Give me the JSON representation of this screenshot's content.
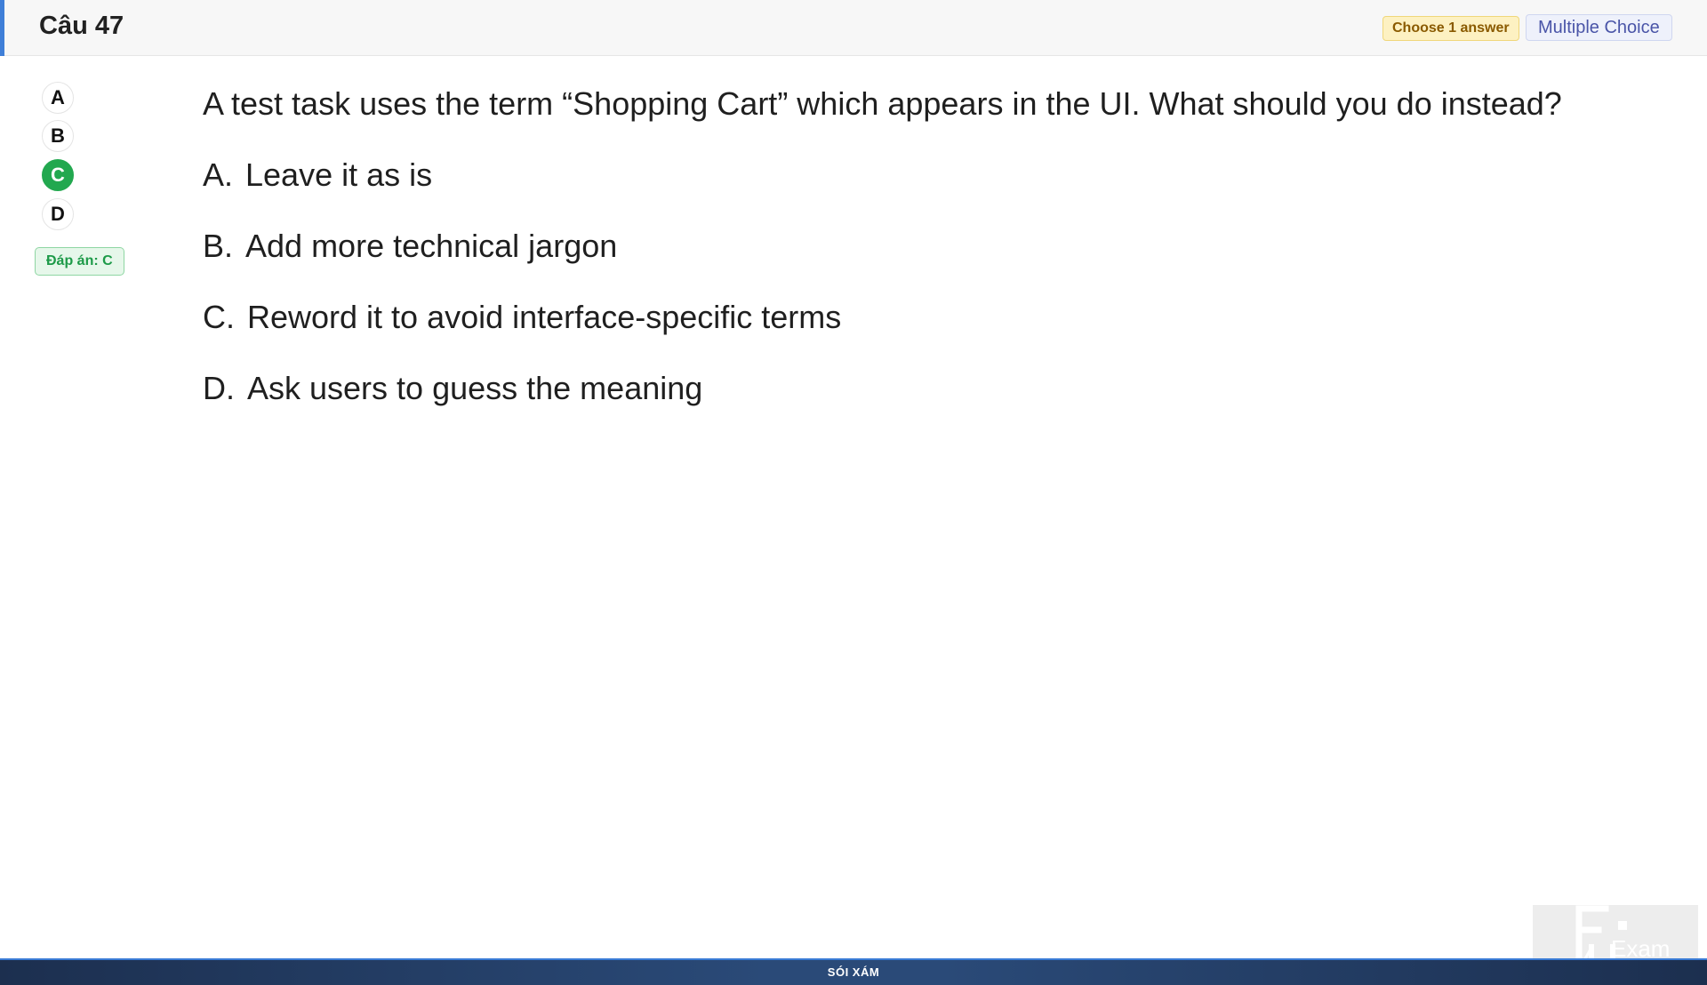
{
  "header": {
    "question_number": "Câu 47",
    "badge_choose": "Choose 1 answer",
    "badge_type": "Multiple Choice"
  },
  "answer_sidebar": {
    "options": [
      "A",
      "B",
      "C",
      "D"
    ],
    "selected": "C",
    "answer_label": "Đáp án: C"
  },
  "question": {
    "text": "A test task uses the term “Shopping Cart” which appears in the UI. What should you do instead?",
    "options": [
      {
        "letter": "A.",
        "text": "Leave it as is"
      },
      {
        "letter": "B.",
        "text": "Add more technical jargon"
      },
      {
        "letter": "C.",
        "text": "Reword it to avoid interface-specific terms"
      },
      {
        "letter": "D.",
        "text": "Ask users to guess the meaning"
      }
    ]
  },
  "footer": {
    "label": "SÓI XÁM"
  },
  "logo": {
    "text": "Exam",
    "icon": "fu-exam-logo-icon"
  },
  "colors": {
    "accent": "#3f7fd8",
    "selected": "#22a84f",
    "footer": "#2a4a78"
  }
}
